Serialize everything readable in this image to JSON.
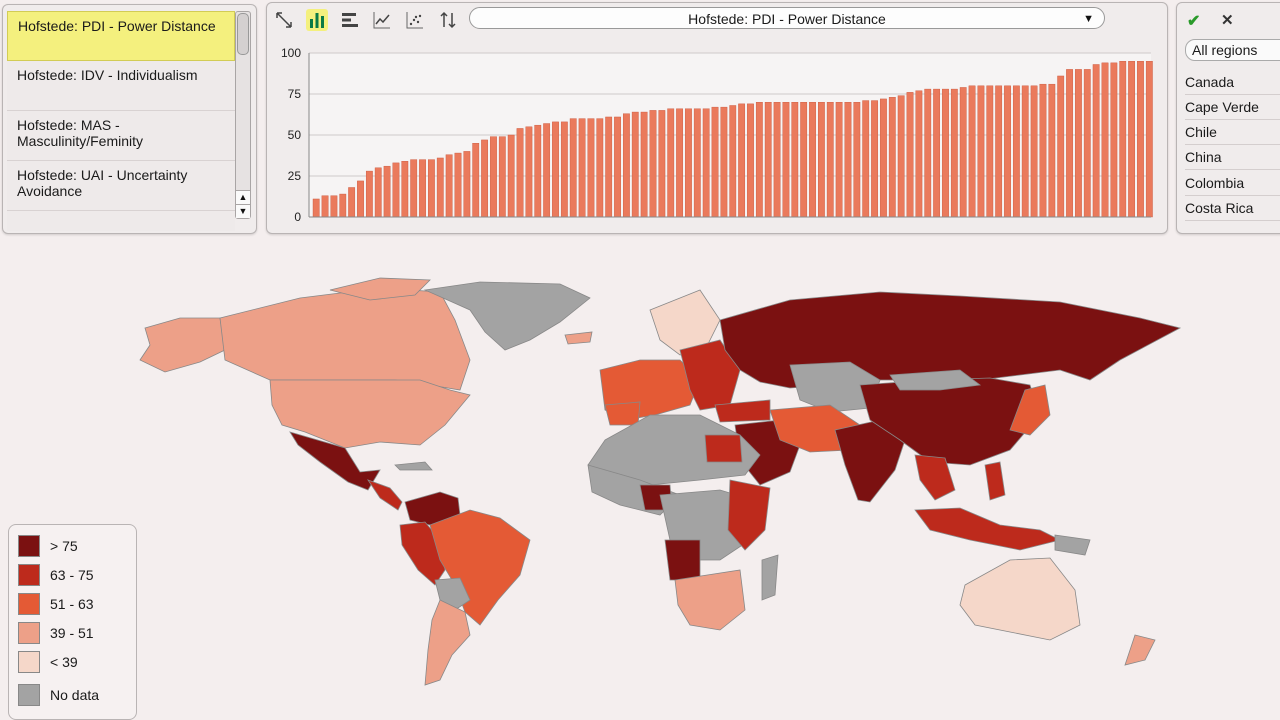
{
  "indicators": [
    {
      "label": "Hofstede: PDI - Power Distance",
      "selected": true
    },
    {
      "label": "Hofstede: IDV - Individualism",
      "selected": false
    },
    {
      "label": "Hofstede: MAS - Masculinity/Feminity",
      "selected": false
    },
    {
      "label": "Hofstede: UAI - Uncertainty Avoidance",
      "selected": false
    }
  ],
  "toolbar": {
    "icons": [
      "expand-icon",
      "bar-chart-icon",
      "horizontal-bar-icon",
      "line-chart-icon",
      "scatter-icon",
      "sort-icon"
    ],
    "selected_indicator": "Hofstede: PDI - Power Distance"
  },
  "regions": {
    "confirm_icon": "check-icon",
    "clear_icon": "close-icon",
    "all_label": "All regions",
    "items": [
      "Canada",
      "Cape Verde",
      "Chile",
      "China",
      "Colombia",
      "Costa Rica"
    ]
  },
  "legend": [
    {
      "label": "> 75",
      "color": "#7b1111"
    },
    {
      "label": "63 - 75",
      "color": "#bd2a1c"
    },
    {
      "label": "51 - 63",
      "color": "#e45a35"
    },
    {
      "label": "39 - 51",
      "color": "#eda088"
    },
    {
      "label": "< 39",
      "color": "#f5d7c9"
    },
    {
      "label": "No data",
      "color": "#a3a3a3"
    }
  ],
  "chart_data": {
    "type": "bar",
    "title": "Hofstede: PDI - Power Distance",
    "ylim": [
      0,
      100
    ],
    "yticks": [
      0,
      25,
      50,
      75,
      100
    ],
    "grid": true,
    "bar_color": "#ea7a5c",
    "values": [
      11,
      13,
      13,
      14,
      18,
      22,
      28,
      30,
      31,
      33,
      34,
      35,
      35,
      35,
      36,
      38,
      39,
      40,
      45,
      47,
      49,
      49,
      50,
      54,
      55,
      56,
      57,
      58,
      58,
      60,
      60,
      60,
      60,
      61,
      61,
      63,
      64,
      64,
      65,
      65,
      66,
      66,
      66,
      66,
      66,
      67,
      67,
      68,
      69,
      69,
      70,
      70,
      70,
      70,
      70,
      70,
      70,
      70,
      70,
      70,
      70,
      70,
      71,
      71,
      72,
      73,
      74,
      76,
      77,
      78,
      78,
      78,
      78,
      79,
      80,
      80,
      80,
      80,
      80,
      80,
      80,
      80,
      81,
      81,
      86,
      90,
      90,
      90,
      93,
      94,
      94,
      95,
      95,
      95,
      95
    ]
  },
  "map": {
    "label": "World map of Power Distance Index by country"
  }
}
